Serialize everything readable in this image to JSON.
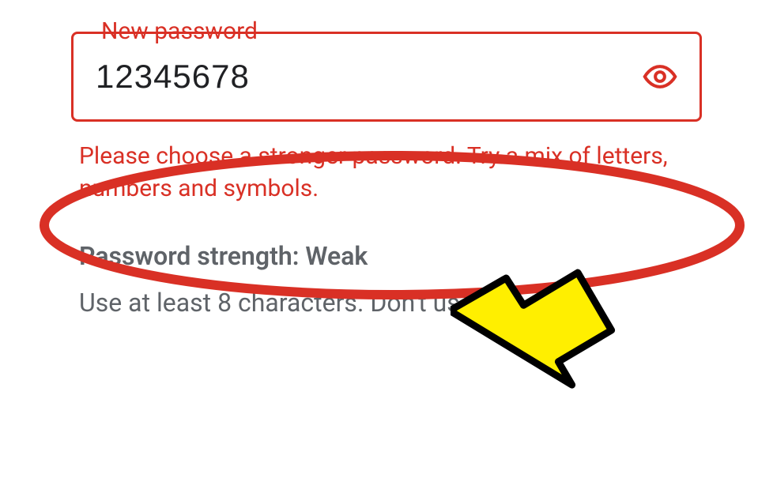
{
  "field": {
    "label": "New password",
    "value": "12345678",
    "error": "Please choose a stronger password. Try a mix of letters, numbers and symbols."
  },
  "strength": {
    "label": "Password strength:",
    "value": "Weak"
  },
  "hint": "Use at least 8 characters. Don't use a",
  "colors": {
    "error": "#d93025",
    "arrowFill": "#ffef00",
    "text": "#5f6368"
  }
}
